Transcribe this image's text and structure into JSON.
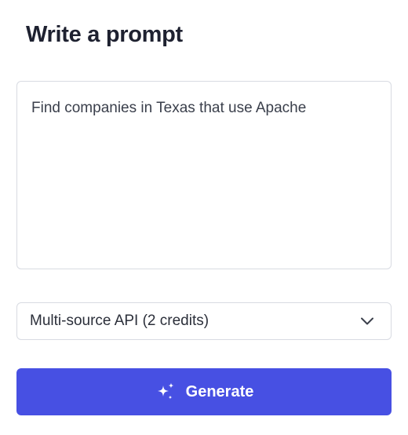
{
  "header": {
    "title": "Write a prompt"
  },
  "prompt": {
    "value": "Find companies in Texas that use Apache"
  },
  "source_select": {
    "selected": "Multi-source API (2 credits)",
    "icon": "chevron-down-icon"
  },
  "generate_button": {
    "label": "Generate",
    "icon": "sparkles-icon",
    "color": "#4750e3"
  }
}
